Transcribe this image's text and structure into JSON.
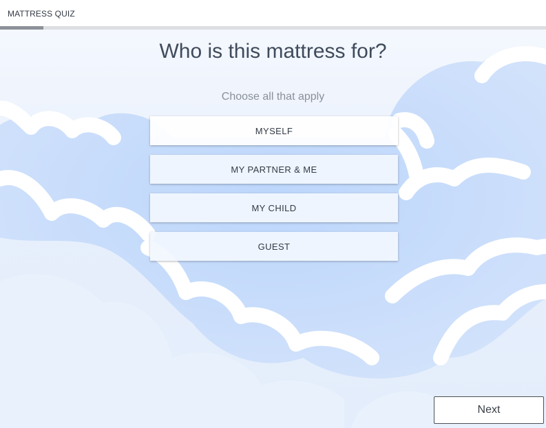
{
  "header": {
    "title": "MATTRESS QUIZ"
  },
  "progress": {
    "fraction": 0.08
  },
  "question": {
    "title": "Who is this mattress for?",
    "hint": "Choose all that apply"
  },
  "options": [
    {
      "label": "MYSELF"
    },
    {
      "label": "MY PARTNER & ME"
    },
    {
      "label": "MY CHILD"
    },
    {
      "label": "GUEST"
    }
  ],
  "footer": {
    "next_label": "Next"
  },
  "colors": {
    "sky": "#dfeafb",
    "cloud_shadow": "#bcd6fb",
    "cloud": "#ffffff",
    "progress_fill": "#8d9199",
    "progress_track": "#dcdee2"
  }
}
